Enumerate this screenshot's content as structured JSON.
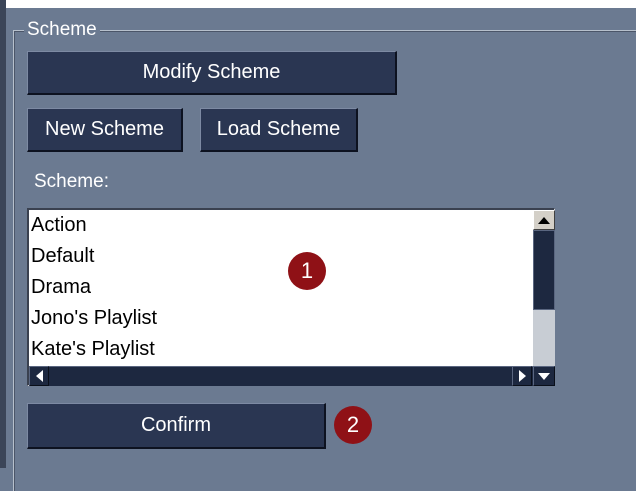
{
  "group": {
    "title": "Scheme"
  },
  "buttons": {
    "modify": "Modify Scheme",
    "new": "New Scheme",
    "load": "Load Scheme",
    "confirm": "Confirm"
  },
  "list": {
    "label": "Scheme:",
    "items": [
      "Action",
      "Default",
      "Drama",
      "Jono's Playlist",
      "Kate's Playlist"
    ]
  },
  "callouts": {
    "one": "1",
    "two": "2"
  },
  "colors": {
    "panel_background": "#6b7a91",
    "button_background": "#2a3652",
    "callout_badge": "#8f1116"
  },
  "icons": {
    "scroll_up": "arrow-up-icon",
    "scroll_down": "arrow-down-icon",
    "scroll_left": "arrow-left-icon",
    "scroll_right": "arrow-right-icon"
  }
}
